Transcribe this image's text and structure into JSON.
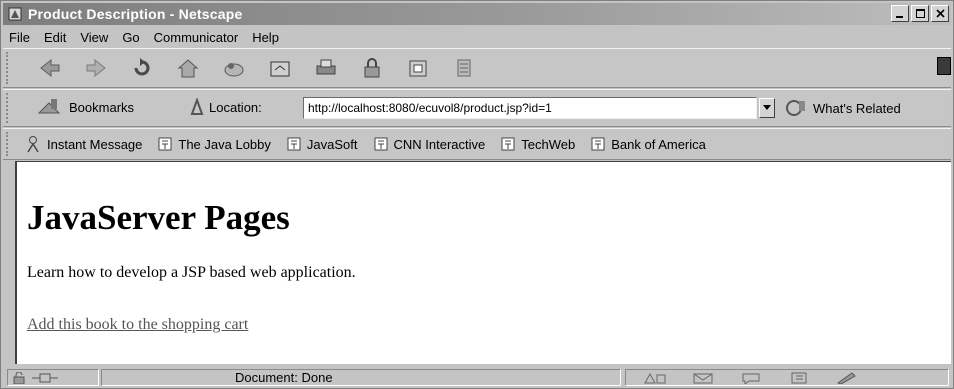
{
  "window": {
    "title": "Product Description - Netscape"
  },
  "menu": [
    "File",
    "Edit",
    "View",
    "Go",
    "Communicator",
    "Help"
  ],
  "nav_toolbar": {
    "icons": [
      "back-icon",
      "forward-icon",
      "reload-icon",
      "home-icon",
      "search-icon",
      "netscape-icon",
      "print-icon",
      "security-icon",
      "shop-icon",
      "stop-icon"
    ]
  },
  "location_toolbar": {
    "bookmarks_label": "Bookmarks",
    "location_label": "Location:",
    "url": "http://localhost:8080/ecuvol8/product.jsp?id=1",
    "related_label": "What's Related"
  },
  "personal_toolbar": {
    "items": [
      "Instant Message",
      "The Java Lobby",
      "JavaSoft",
      "CNN Interactive",
      "TechWeb",
      "Bank of America"
    ]
  },
  "page": {
    "heading": "JavaServer Pages",
    "description": "Learn how to develop a JSP based web application.",
    "link_text": "Add this book to the shopping cart"
  },
  "status": {
    "text": "Document: Done"
  }
}
